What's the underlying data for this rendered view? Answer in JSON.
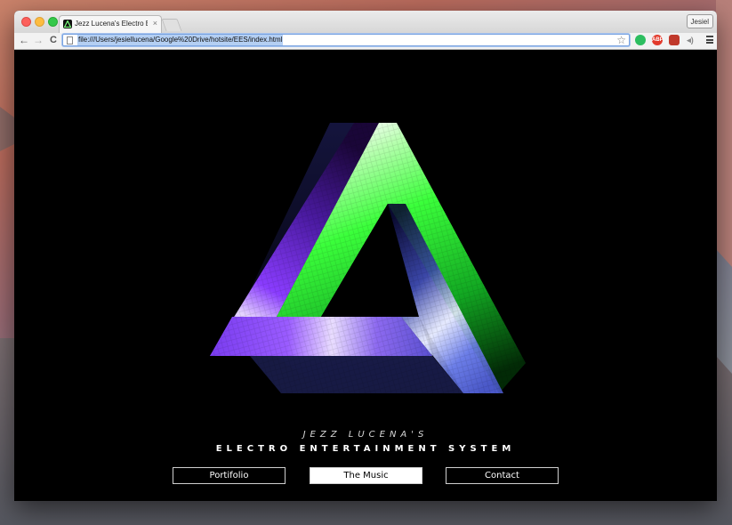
{
  "browser": {
    "tab_title": "Jezz Lucena's Electro Ente",
    "tab_close": "×",
    "profile_label": "Jesiel",
    "url": "file:///Users/jesiellucena/Google%20Drive/hotsite/EES/index.html",
    "back_icon": "←",
    "forward_icon": "→",
    "reload_icon": "C",
    "star_icon": "☆",
    "extensions": [
      {
        "name": "evernote-icon",
        "label": "",
        "color": "#2dbe60"
      },
      {
        "name": "adblock-icon",
        "label": "ABP",
        "color": "#e23a2c"
      },
      {
        "name": "extension-icon",
        "label": "",
        "color": "#c0392b"
      },
      {
        "name": "speaker-icon",
        "label": "",
        "color": "#888888"
      }
    ]
  },
  "page": {
    "subtitle": "JEZZ LUCENA'S",
    "title": "ELECTRO ENTERTAINMENT SYSTEM",
    "nav": [
      {
        "label": "Portifolio",
        "active": false
      },
      {
        "label": "The Music",
        "active": true
      },
      {
        "label": "Contact",
        "active": false
      }
    ],
    "logo_colors": {
      "green": "#3bff3b",
      "purple": "#8a3cff",
      "blue": "#6f7fe0",
      "white": "#ffffff"
    }
  }
}
